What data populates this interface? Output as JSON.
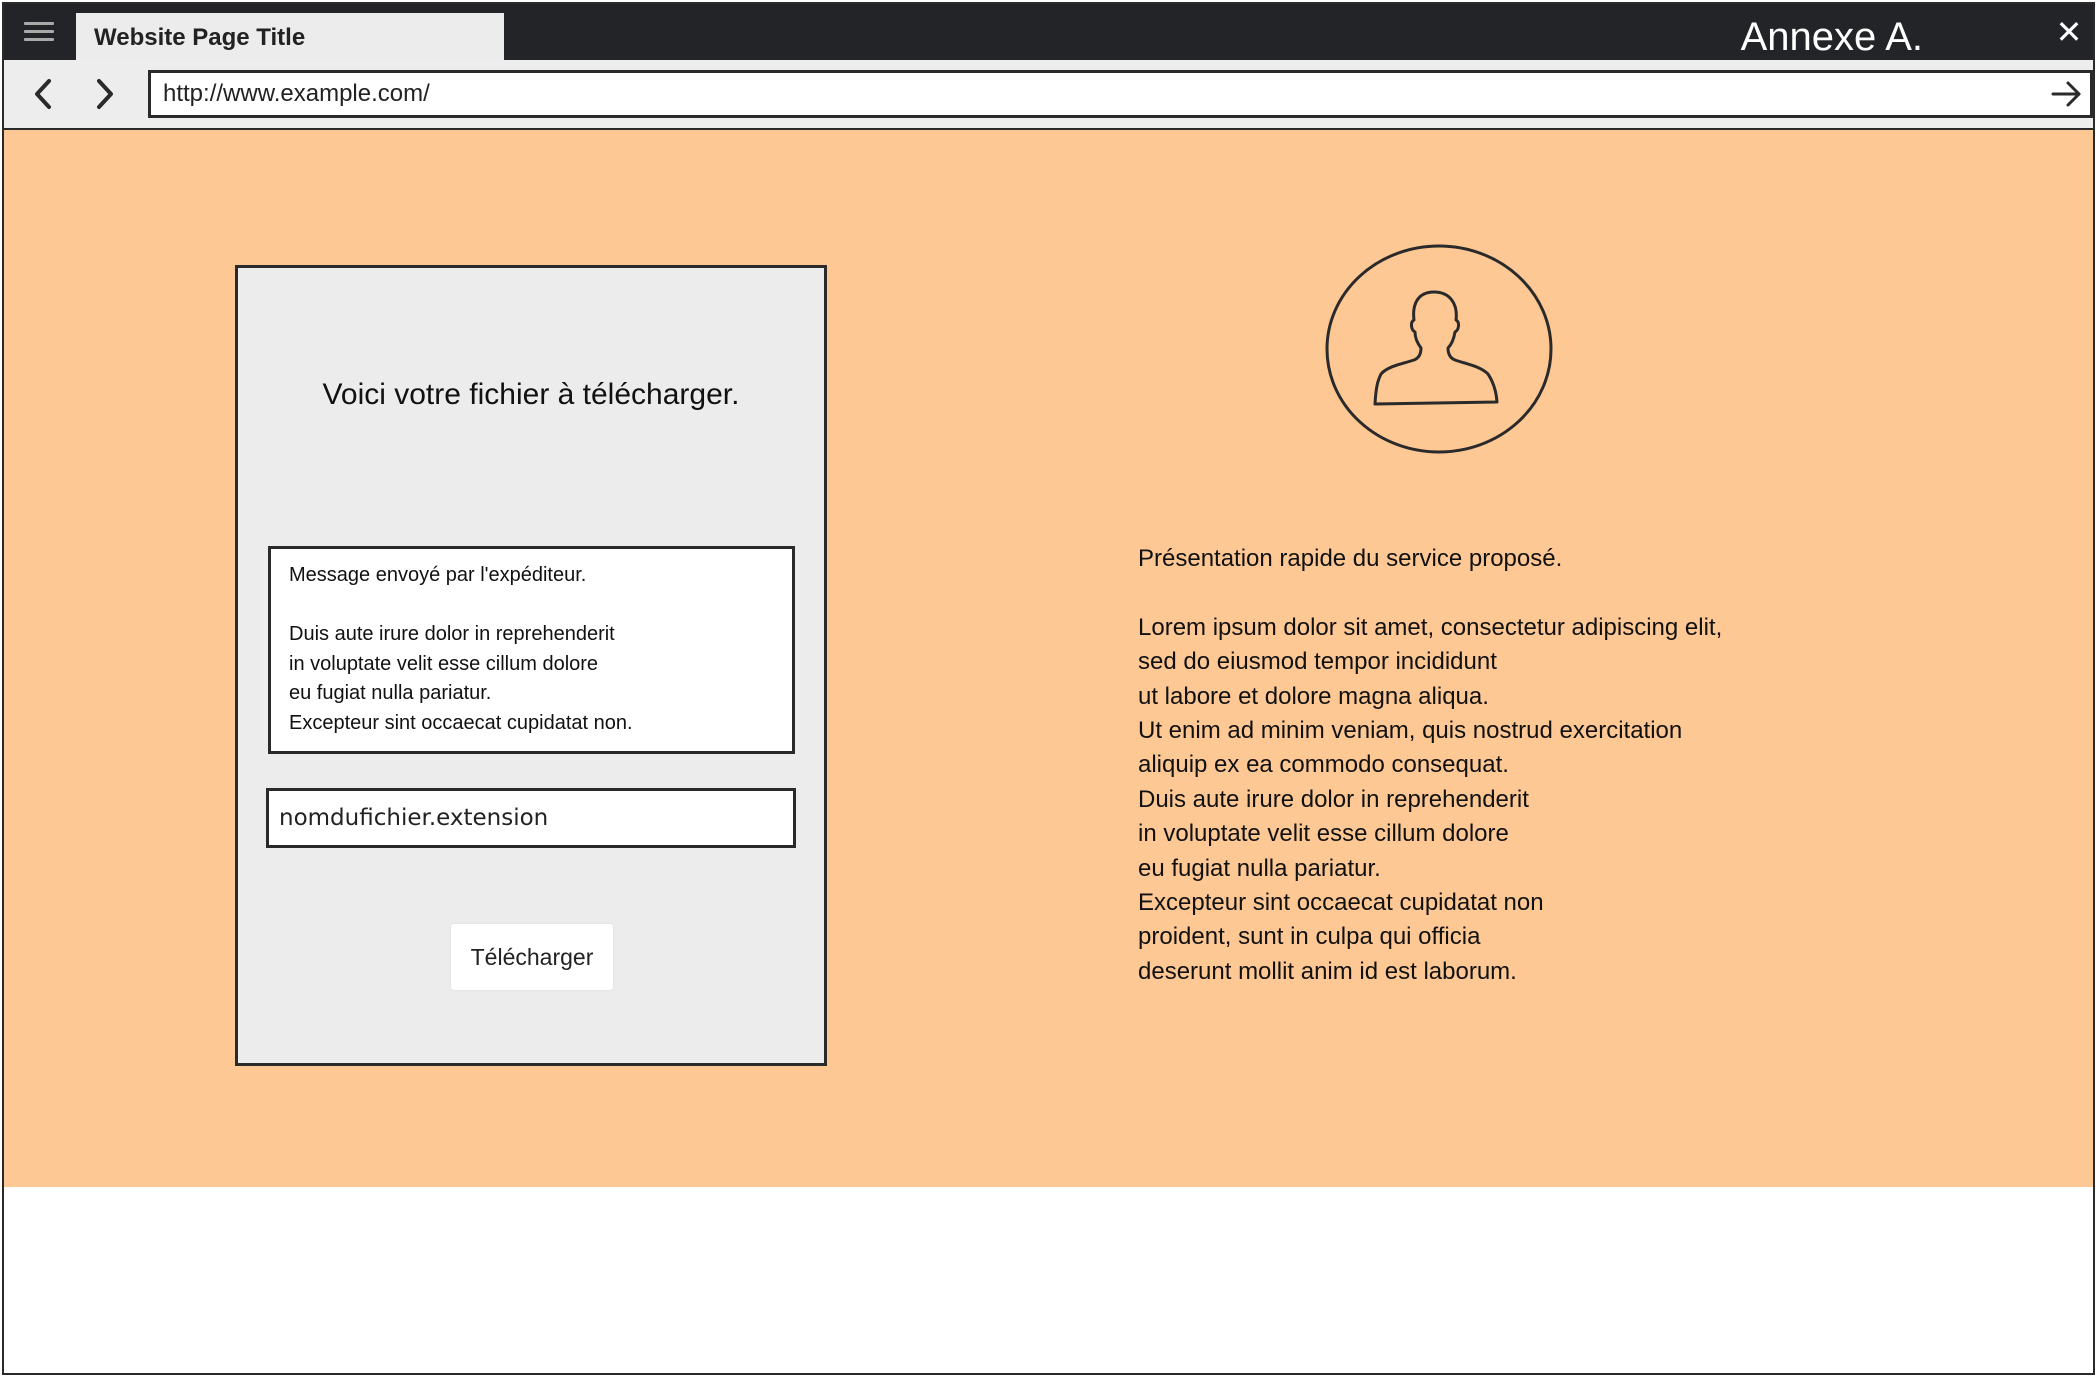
{
  "browser": {
    "tab_title": "Website Page Title",
    "window_label": "Annexe A.",
    "url": "http://www.example.com/",
    "icons": {
      "menu": "hamburger-menu-icon",
      "close": "close-icon",
      "back": "chevron-left-icon",
      "forward": "chevron-right-icon",
      "go": "arrow-right-icon"
    }
  },
  "download_card": {
    "title": "Voici votre fichier à télécharger.",
    "message_header": "Message envoyé par l'expéditeur.",
    "message_lines": [
      "Duis aute irure dolor in reprehenderit",
      "in voluptate velit esse cillum dolore",
      "eu fugiat nulla pariatur.",
      "Excepteur sint occaecat cupidatat non."
    ],
    "filename": "nomdufichier.extension",
    "download_button": "Télécharger"
  },
  "service": {
    "avatar_icon": "user-avatar-icon",
    "heading": "Présentation rapide du service proposé.",
    "lines": [
      "Lorem ipsum dolor sit amet, consectetur adipiscing elit,",
      "sed do eiusmod tempor incididunt",
      "ut labore et dolore magna aliqua.",
      "Ut enim ad minim veniam, quis nostrud exercitation",
      "aliquip ex ea commodo consequat.",
      "Duis aute irure dolor in reprehenderit",
      "in voluptate velit esse cillum dolore",
      "eu fugiat nulla pariatur.",
      "Excepteur sint occaecat cupidatat non",
      "proident, sunt in culpa qui officia",
      "deserunt mollit anim id est laborum."
    ]
  },
  "colors": {
    "titlebar": "#232427",
    "page_background": "#fec895",
    "card_background": "#ececec",
    "border": "#2a2a2a"
  }
}
